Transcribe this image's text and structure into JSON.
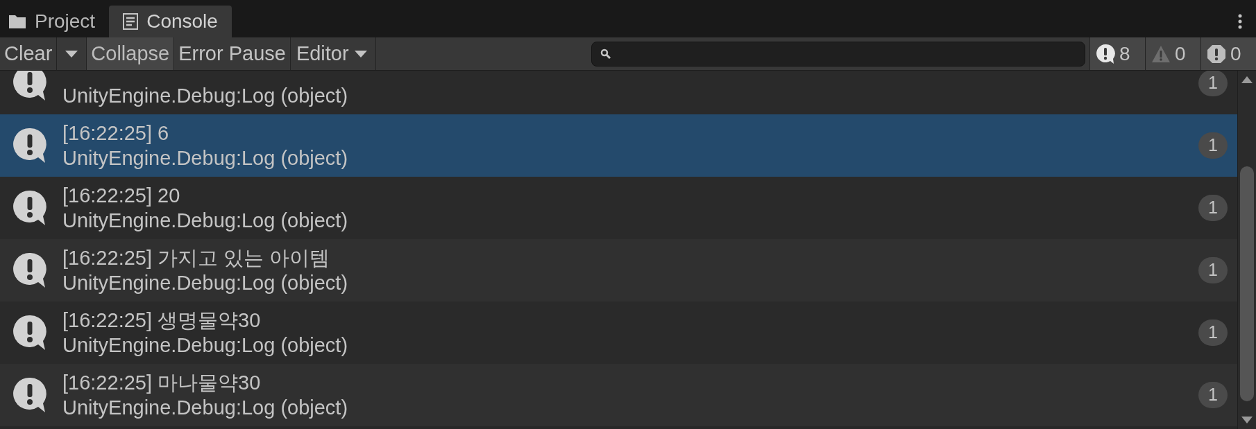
{
  "tabs": [
    {
      "label": "Project",
      "kind": "folder",
      "selected": false
    },
    {
      "label": "Console",
      "kind": "console",
      "selected": true
    }
  ],
  "toolbar": [
    {
      "label": "Clear",
      "kind": "button",
      "selected": false
    },
    {
      "kind": "caret",
      "selected": false
    },
    {
      "label": "Collapse",
      "kind": "toggle",
      "selected": true
    },
    {
      "label": "Error Pause",
      "kind": "toggle",
      "selected": false
    },
    {
      "label": "Editor",
      "kind": "dropdown",
      "selected": false
    }
  ],
  "counters": [
    {
      "kind": "info",
      "count": "8"
    },
    {
      "kind": "warning",
      "count": "0"
    },
    {
      "kind": "error",
      "count": "0"
    }
  ],
  "rows": [
    {
      "source": "UnityEngine.Debug:Log (object)",
      "count": "1",
      "selected": false
    },
    {
      "message": "[16:22:25] 6",
      "source": "UnityEngine.Debug:Log (object)",
      "count": "1",
      "selected": true
    },
    {
      "message": "[16:22:25] 20",
      "source": "UnityEngine.Debug:Log (object)",
      "count": "1",
      "selected": false
    },
    {
      "message": "[16:22:25] 가지고 있는 아이템",
      "source": "UnityEngine.Debug:Log (object)",
      "count": "1",
      "selected": false
    },
    {
      "message": "[16:22:25] 생명물약30",
      "source": "UnityEngine.Debug:Log (object)",
      "count": "1",
      "selected": false
    },
    {
      "message": "[16:22:25] 마나물약30",
      "source": "UnityEngine.Debug:Log (object)",
      "count": "1",
      "selected": false
    }
  ]
}
